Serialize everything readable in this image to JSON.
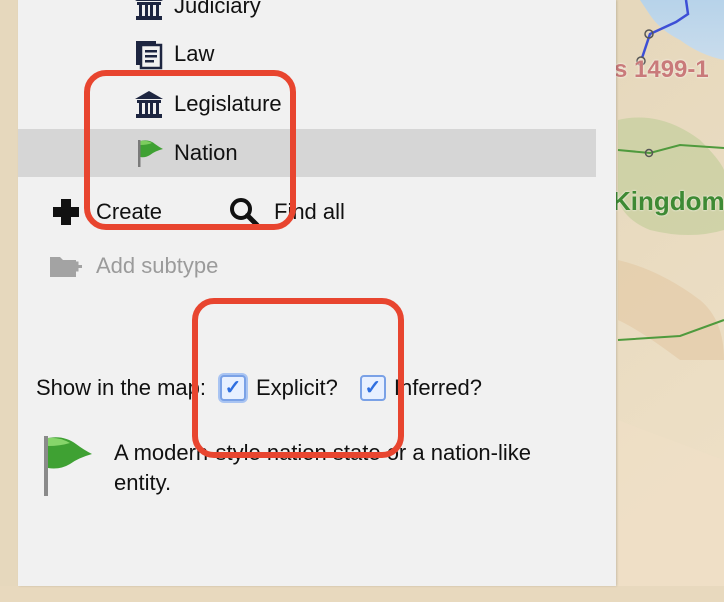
{
  "types": {
    "items": [
      {
        "label": "Judiciary",
        "icon": "courthouse-icon"
      },
      {
        "label": "Law",
        "icon": "document-icon"
      },
      {
        "label": "Legislature",
        "icon": "courthouse-icon"
      },
      {
        "label": "Nation",
        "icon": "flag-icon"
      }
    ],
    "selected": "Nation"
  },
  "actions": {
    "create_label": "Create",
    "find_all_label": "Find all",
    "add_subtype_label": "Add subtype"
  },
  "show_in_map": {
    "label": "Show in the map:",
    "explicit_label": "Explicit?",
    "explicit_checked": true,
    "inferred_label": "Inferred?",
    "inferred_checked": true
  },
  "description": {
    "text": "A modern-style nation state or a nation-like entity.",
    "icon": "flag-icon"
  },
  "map": {
    "labels": {
      "years_fragment": "s 1499-1",
      "kingdom_fragment": "Kingdom"
    }
  },
  "colors": {
    "annotation": "#e8452f",
    "selected_row": "#d6d6d6",
    "panel_bg": "#f1f1f1",
    "checkbox_accent": "#2f6fe0",
    "map_label_red": "#c97a7a",
    "map_label_green": "#3e8a34"
  }
}
